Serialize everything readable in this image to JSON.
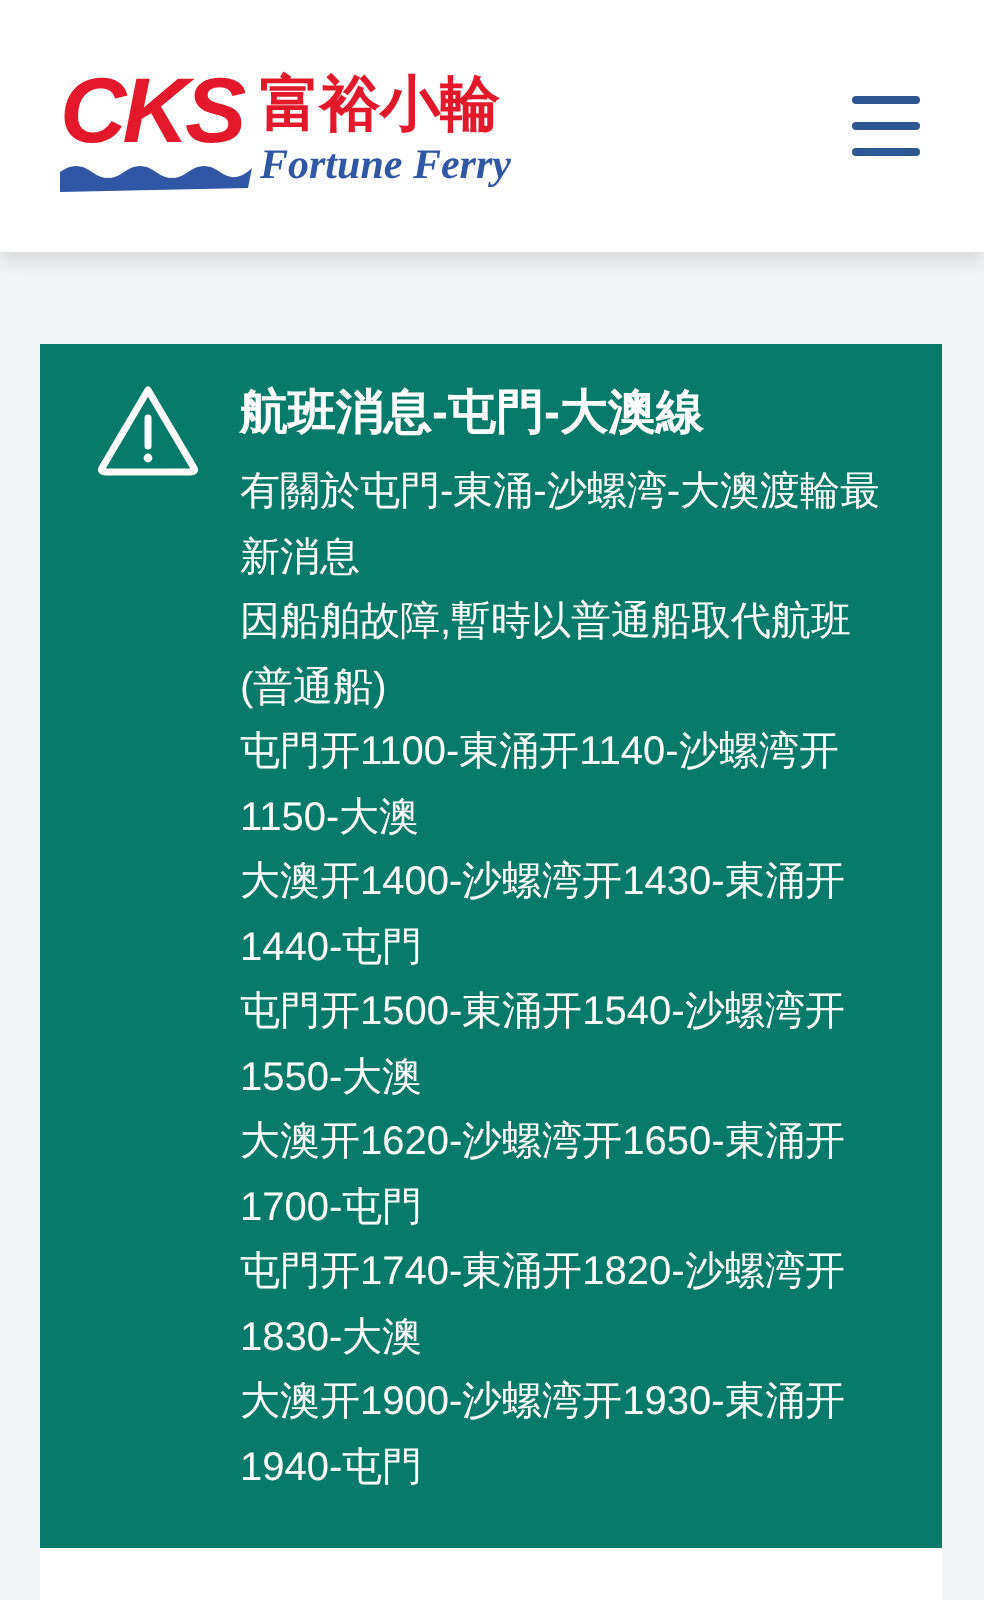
{
  "header": {
    "logo": {
      "mark": "CKS",
      "name_zh": "富裕小輪",
      "name_en": "Fortune Ferry"
    }
  },
  "notice": {
    "title": "航班消息-屯門-大澳線",
    "paragraphs": [
      "有關於屯門-東涌-沙螺湾-大澳渡輪最新消息",
      "因船舶故障,暫時以普通船取代航班(普通船)",
      "屯門开1100-東涌开1140-沙螺湾开1150-大澳",
      "大澳开1400-沙螺湾开1430-東涌开1440-屯門",
      "屯門开1500-東涌开1540-沙螺湾开1550-大澳",
      "大澳开1620-沙螺湾开1650-東涌开1700-屯門",
      "屯門开1740-東涌开1820-沙螺湾开1830-大澳",
      "大澳开1900-沙螺湾开1930-東涌开1940-屯門"
    ]
  }
}
